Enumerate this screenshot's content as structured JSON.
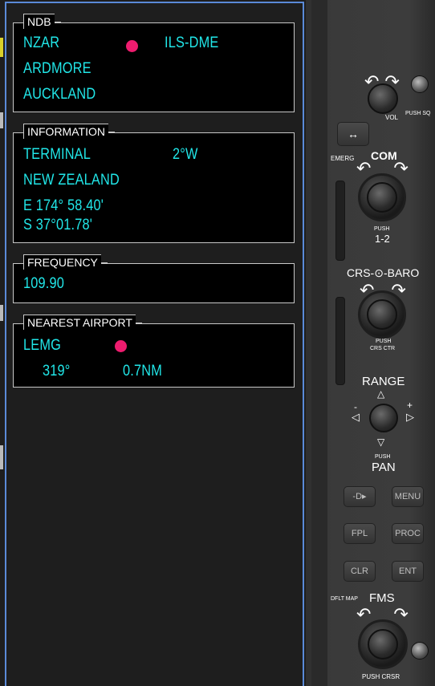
{
  "ndb": {
    "title": "NDB",
    "ident": "NZAR",
    "type": "ILS-DME",
    "name": "ARDMORE",
    "city": "AUCKLAND"
  },
  "information": {
    "title": "INFORMATION",
    "region": "TERMINAL",
    "magvar": "2°W",
    "country": "NEW ZEALAND",
    "lon": "E 174° 58.40'",
    "lat": "S 37°01.78'"
  },
  "frequency": {
    "title": "FREQUENCY",
    "value": "109.90"
  },
  "nearest_airport": {
    "title": "NEAREST AIRPORT",
    "ident": "LEMG",
    "bearing": "319°",
    "distance": "0.7NM"
  },
  "bezel": {
    "vol_label": "VOL",
    "push_sq": "PUSH SQ",
    "emerg": "EMERG",
    "com": "COM",
    "push": "PUSH",
    "one_two": "1-2",
    "crs_baro": "CRS-⊙-BARO",
    "crs_ctr": "CRS CTR",
    "range": "RANGE",
    "pan": "PAN",
    "direct_to": "-D▸",
    "menu": "MENU",
    "fpl": "FPL",
    "proc": "PROC",
    "clr": "CLR",
    "ent": "ENT",
    "dflt_map": "DFLT MAP",
    "fms": "FMS",
    "push_crsr": "PUSH CRSR"
  },
  "colors": {
    "cyan": "#21e6e8",
    "magenta_dot": "#ee1c6e",
    "border_blue": "#5a8ad8"
  }
}
